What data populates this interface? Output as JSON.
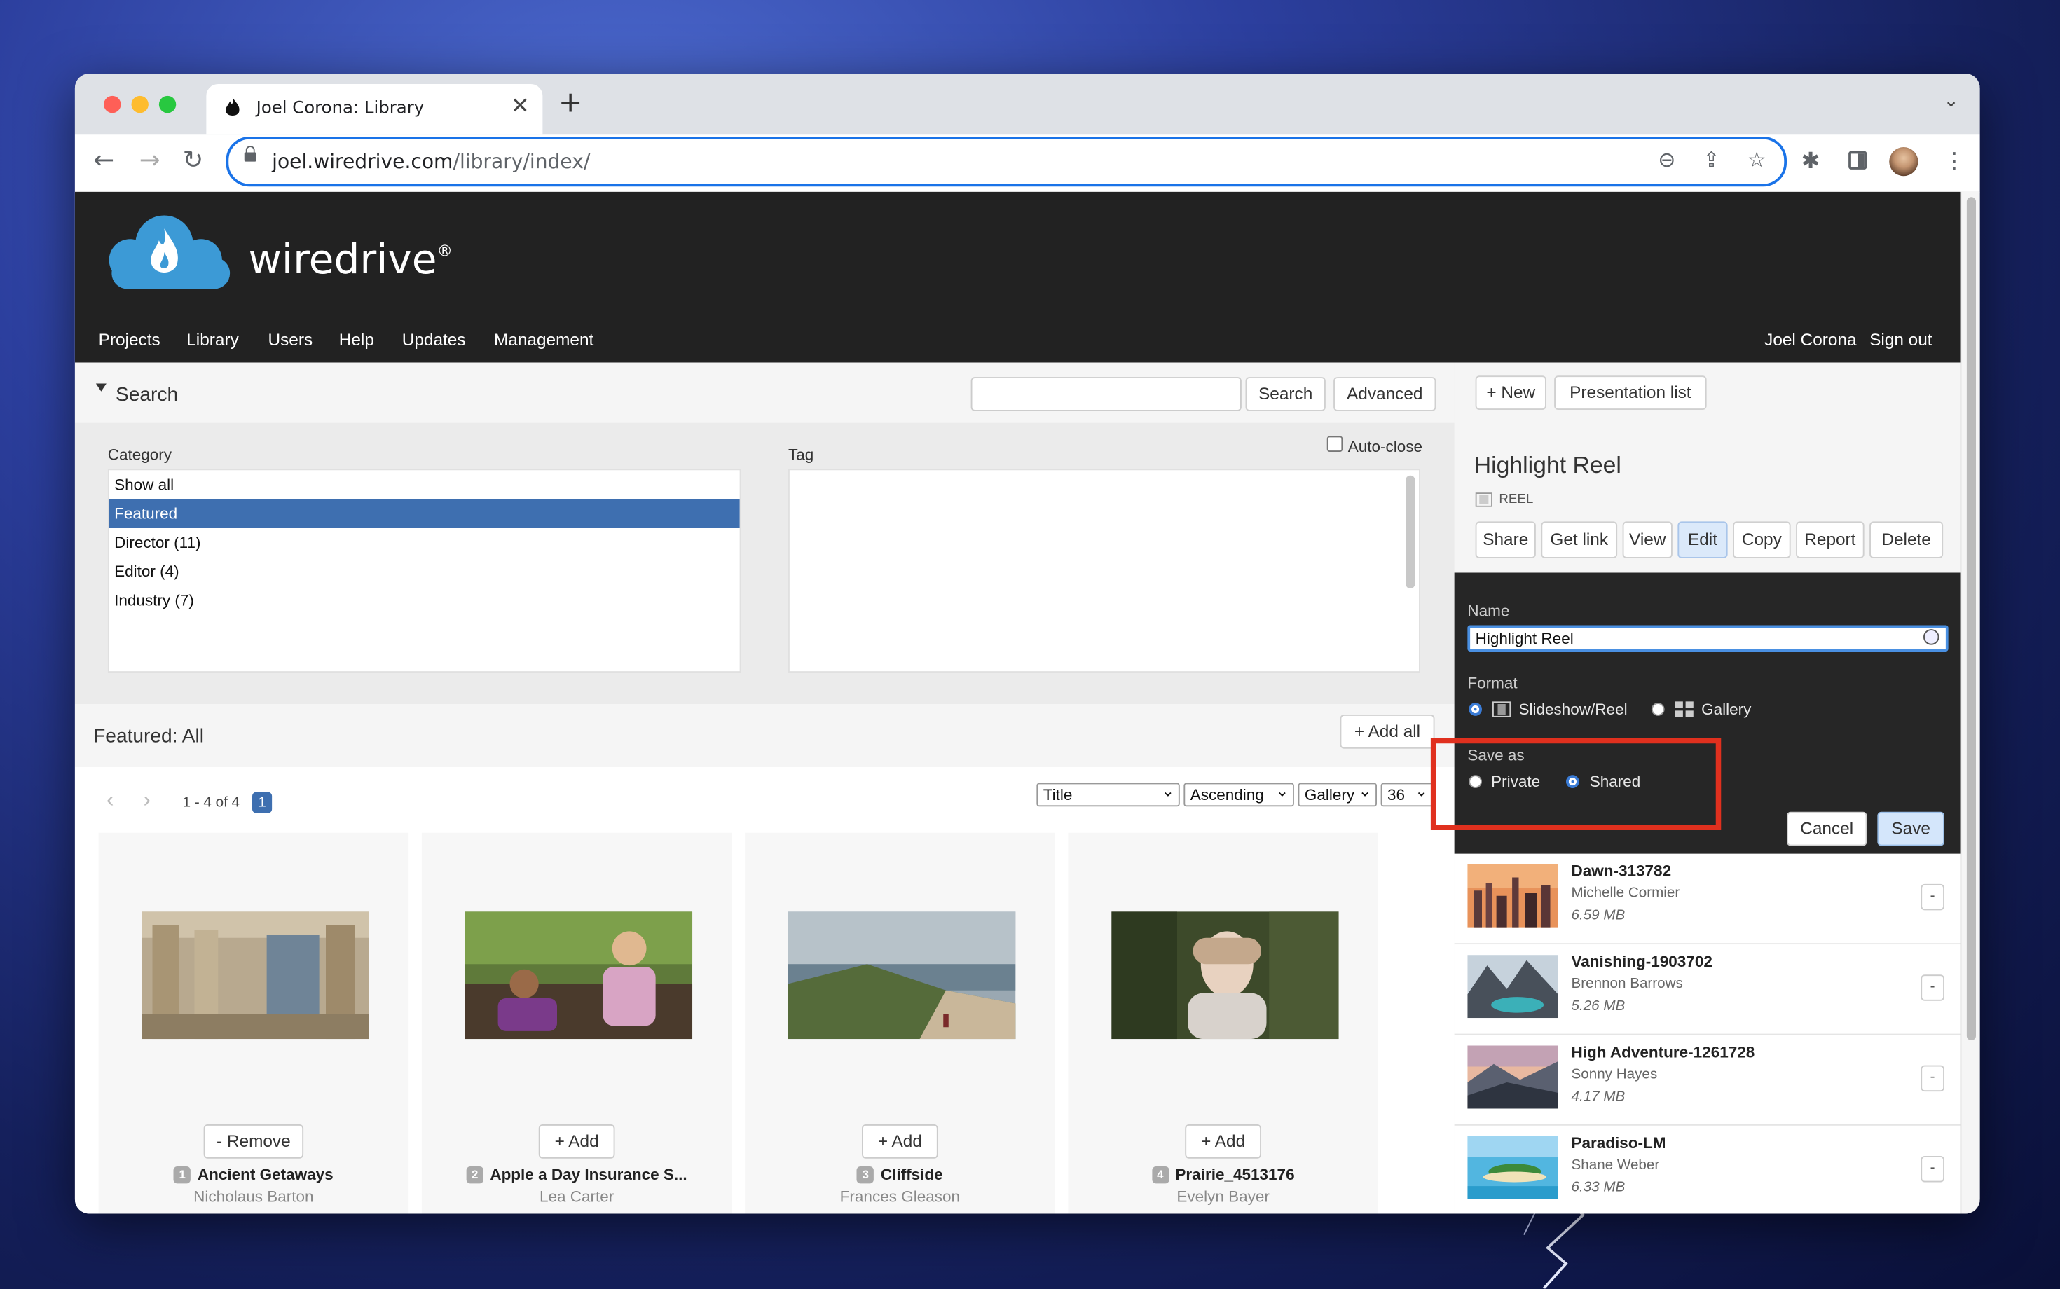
{
  "browser": {
    "tab_title": "Joel Corona: Library",
    "url_domain": "joel.wiredrive.com",
    "url_path": "/library/index/"
  },
  "site": {
    "logo_text": "wiredrive",
    "logo_mark": "®",
    "nav_left": [
      "Projects",
      "Library",
      "Users",
      "Help",
      "Updates",
      "Management"
    ],
    "user_name": "Joel Corona",
    "sign_out": "Sign out"
  },
  "search": {
    "heading": "Search",
    "input_value": "",
    "search_button": "Search",
    "advanced_button": "Advanced"
  },
  "filters": {
    "category_label": "Category",
    "categories": [
      "Show all",
      "Featured",
      "Director (11)",
      "Editor (4)",
      "Industry (7)"
    ],
    "selected_category": "Featured",
    "tag_label": "Tag",
    "autoclose_label": "Auto-close",
    "autoclose_checked": false
  },
  "results": {
    "heading": "Featured: All",
    "add_all": "+ Add all",
    "range": "1 - 4 of 4",
    "page": "1",
    "sort_field": "Title",
    "sort_order": "Ascending",
    "view_mode": "Gallery",
    "per_page": "36",
    "items": [
      {
        "num": "1",
        "title": "Ancient Getaways",
        "author": "Nicholaus Barton",
        "action": "- Remove"
      },
      {
        "num": "2",
        "title": "Apple a Day Insurance S...",
        "author": "Lea Carter",
        "action": "+ Add"
      },
      {
        "num": "3",
        "title": "Cliffside",
        "author": "Frances Gleason",
        "action": "+ Add"
      },
      {
        "num": "4",
        "title": "Prairie_4513176",
        "author": "Evelyn Bayer",
        "action": "+ Add"
      }
    ]
  },
  "presentation": {
    "new_button": "+ New",
    "list_button": "Presentation list",
    "title": "Highlight Reel",
    "type_badge": "REEL",
    "actions": [
      "Share",
      "Get link",
      "View",
      "Edit",
      "Copy",
      "Report",
      "Delete"
    ],
    "active_action": "Edit",
    "form": {
      "name_label": "Name",
      "name_value": "Highlight Reel",
      "format_label": "Format",
      "format_options": [
        "Slideshow/Reel",
        "Gallery"
      ],
      "format_selected": "Slideshow/Reel",
      "save_as_label": "Save as",
      "save_as_options": [
        "Private",
        "Shared"
      ],
      "save_as_selected": "Shared",
      "cancel": "Cancel",
      "save": "Save"
    },
    "items": [
      {
        "title": "Dawn-313782",
        "author": "Michelle Cormier",
        "size": "6.59 MB"
      },
      {
        "title": "Vanishing-1903702",
        "author": "Brennon Barrows",
        "size": "5.26 MB"
      },
      {
        "title": "High Adventure-1261728",
        "author": "Sonny Hayes",
        "size": "4.17 MB"
      },
      {
        "title": "Paradiso-LM",
        "author": "Shane Weber",
        "size": "6.33 MB"
      }
    ],
    "remove_glyph": "-"
  },
  "colors": {
    "highlight_box": "#e0301e",
    "selected_category": "#3e6fb0",
    "accent_blue": "#3a7bd5",
    "header_bg": "#222222",
    "panel_bg": "#262626"
  },
  "icons": [
    "flame-icon",
    "close-icon",
    "plus-icon",
    "back-arrow-icon",
    "forward-arrow-icon",
    "reload-icon",
    "lock-icon",
    "zoom-out-icon",
    "share-icon",
    "star-icon",
    "puzzle-icon",
    "sidebar-icon",
    "menu-icon",
    "caret-down-icon",
    "film-icon",
    "grid-icon",
    "password-key-icon",
    "chevron-left-icon",
    "chevron-right-icon"
  ]
}
